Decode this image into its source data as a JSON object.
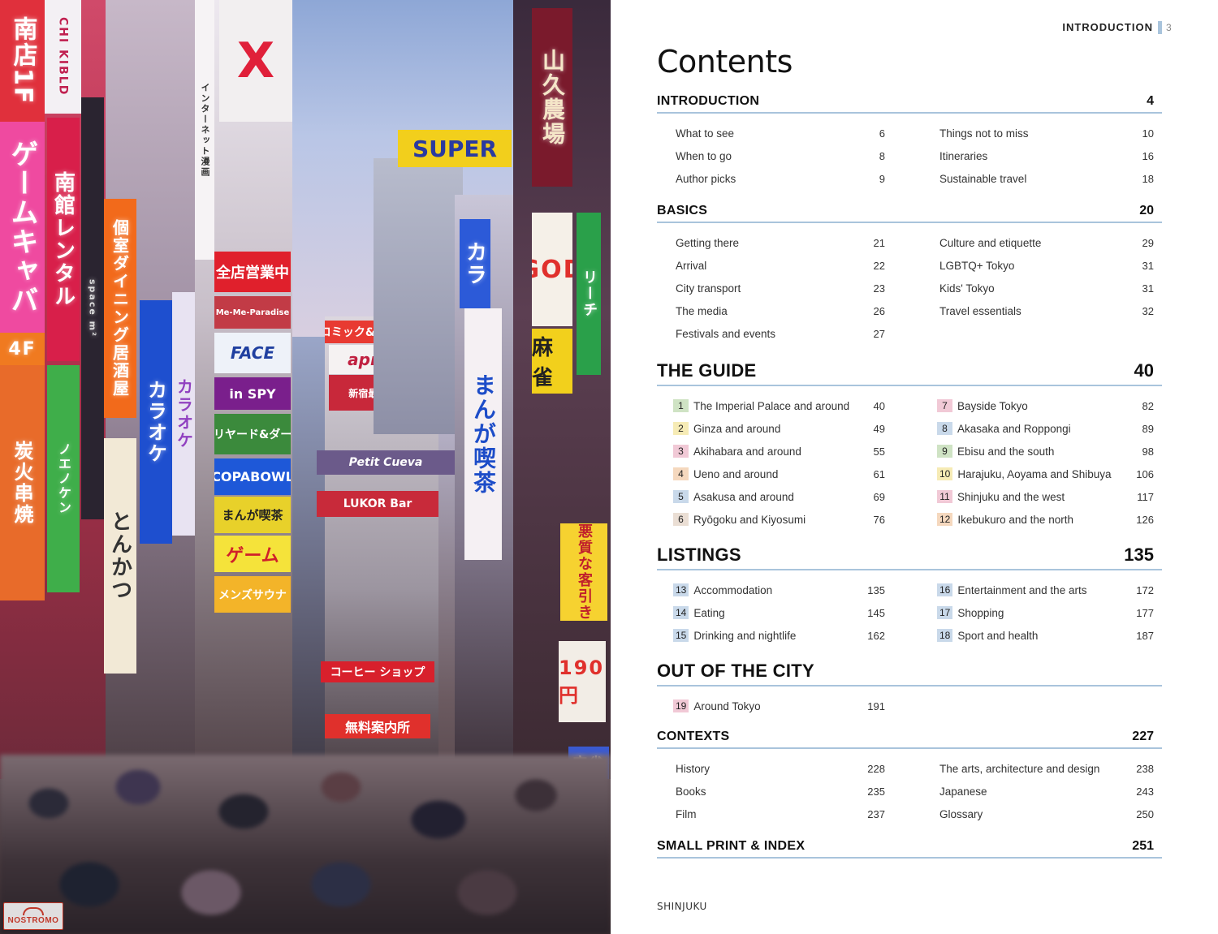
{
  "running_head": "INTRODUCTION",
  "page_number": "3",
  "title": "Contents",
  "caption": "SHINJUKU",
  "photo": {
    "logo_text": "NOSTROMO"
  },
  "colors": {
    "rule": "#a9c4dc",
    "guide_badges": [
      "#cfe3c4",
      "#f6ebb5",
      "#f1c9d6",
      "#f5d8be",
      "#c9d9ea",
      "#eaded4",
      "#f1c9d6",
      "#c9d9ea",
      "#cfe3c4",
      "#f6ebb5",
      "#f1c9d6",
      "#f5d8be"
    ],
    "listings_badges": [
      "#c9d9ea",
      "#c9d9ea",
      "#c9d9ea",
      "#c9d9ea",
      "#c9d9ea",
      "#c9d9ea"
    ],
    "out_badge": "#f1c9d6"
  },
  "sections": {
    "introduction": {
      "title": "INTRODUCTION",
      "page": "4",
      "left": [
        {
          "label": "What to see",
          "page": "6"
        },
        {
          "label": "When to go",
          "page": "8"
        },
        {
          "label": "Author picks",
          "page": "9"
        }
      ],
      "right": [
        {
          "label": "Things not to miss",
          "page": "10"
        },
        {
          "label": "Itineraries",
          "page": "16"
        },
        {
          "label": "Sustainable travel",
          "page": "18"
        }
      ]
    },
    "basics": {
      "title": "BASICS",
      "page": "20",
      "left": [
        {
          "label": "Getting there",
          "page": "21"
        },
        {
          "label": "Arrival",
          "page": "22"
        },
        {
          "label": "City transport",
          "page": "23"
        },
        {
          "label": "The media",
          "page": "26"
        },
        {
          "label": "Festivals and events",
          "page": "27"
        }
      ],
      "right": [
        {
          "label": "Culture and etiquette",
          "page": "29"
        },
        {
          "label": "LGBTQ+ Tokyo",
          "page": "31"
        },
        {
          "label": "Kids' Tokyo",
          "page": "31"
        },
        {
          "label": "Travel essentials",
          "page": "32"
        }
      ]
    },
    "guide": {
      "title": "THE GUIDE",
      "page": "40",
      "left": [
        {
          "num": "1",
          "label": "The Imperial Palace and around",
          "page": "40"
        },
        {
          "num": "2",
          "label": "Ginza and around",
          "page": "49"
        },
        {
          "num": "3",
          "label": "Akihabara and around",
          "page": "55"
        },
        {
          "num": "4",
          "label": "Ueno and around",
          "page": "61"
        },
        {
          "num": "5",
          "label": "Asakusa and around",
          "page": "69"
        },
        {
          "num": "6",
          "label": "Ryōgoku and Kiyosumi",
          "page": "76"
        }
      ],
      "right": [
        {
          "num": "7",
          "label": "Bayside Tokyo",
          "page": "82"
        },
        {
          "num": "8",
          "label": "Akasaka and Roppongi",
          "page": "89"
        },
        {
          "num": "9",
          "label": "Ebisu and the south",
          "page": "98"
        },
        {
          "num": "10",
          "label": "Harajuku, Aoyama and Shibuya",
          "page": "106"
        },
        {
          "num": "11",
          "label": "Shinjuku and the west",
          "page": "117"
        },
        {
          "num": "12",
          "label": "Ikebukuro and the north",
          "page": "126"
        }
      ]
    },
    "listings": {
      "title": "LISTINGS",
      "page": "135",
      "left": [
        {
          "num": "13",
          "label": "Accommodation",
          "page": "135"
        },
        {
          "num": "14",
          "label": "Eating",
          "page": "145"
        },
        {
          "num": "15",
          "label": "Drinking and nightlife",
          "page": "162"
        }
      ],
      "right": [
        {
          "num": "16",
          "label": "Entertainment and the arts",
          "page": "172"
        },
        {
          "num": "17",
          "label": "Shopping",
          "page": "177"
        },
        {
          "num": "18",
          "label": "Sport and health",
          "page": "187"
        }
      ]
    },
    "out_of_city": {
      "title": "OUT OF THE CITY",
      "page": "",
      "left": [
        {
          "num": "19",
          "label": "Around Tokyo",
          "page": "191"
        }
      ],
      "right": []
    },
    "contexts": {
      "title": "CONTEXTS",
      "page": "227",
      "left": [
        {
          "label": "History",
          "page": "228"
        },
        {
          "label": "Books",
          "page": "235"
        },
        {
          "label": "Film",
          "page": "237"
        }
      ],
      "right": [
        {
          "label": "The arts, architecture and design",
          "page": "238"
        },
        {
          "label": "Japanese",
          "page": "243"
        },
        {
          "label": "Glossary",
          "page": "250"
        }
      ]
    },
    "small_print": {
      "title": "SMALL PRINT & INDEX",
      "page": "251"
    }
  }
}
